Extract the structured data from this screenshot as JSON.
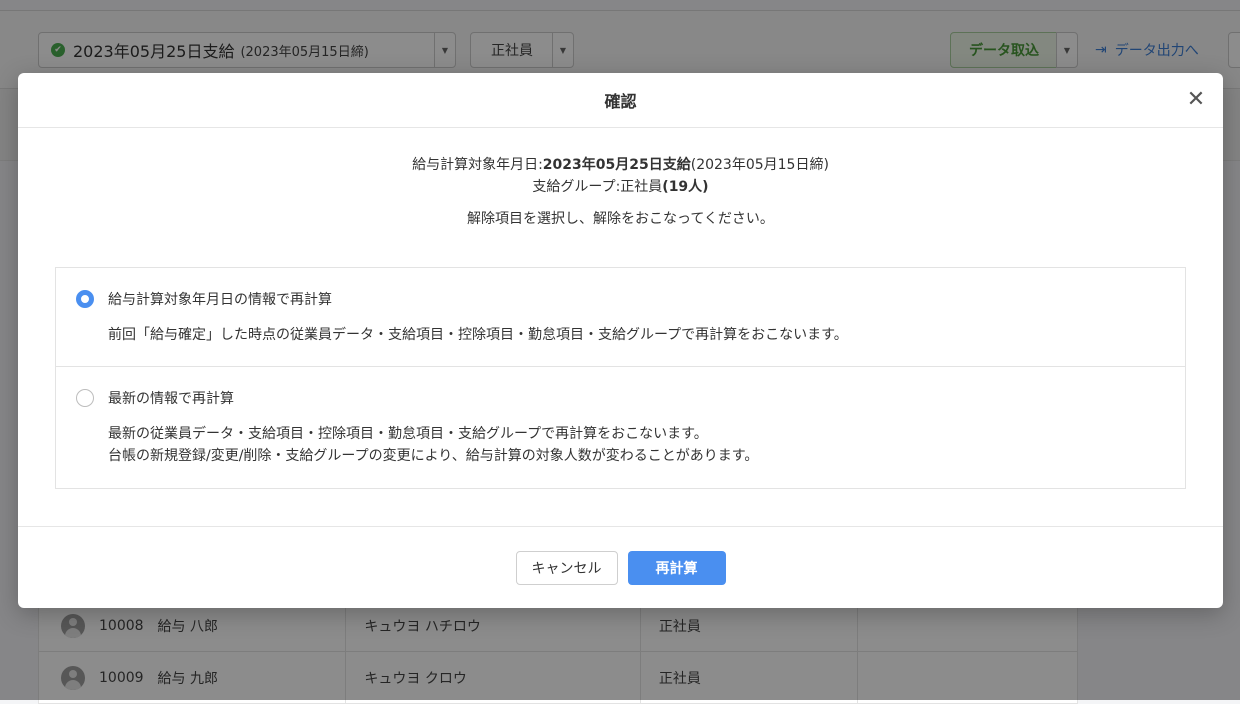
{
  "background": {
    "period_label": "2023年05月25日支給",
    "period_sub": "(2023年05月15日締)",
    "group_select": "正社員",
    "import_button": "データ取込",
    "export_link": "データ出力へ",
    "rows": [
      {
        "code": "10008",
        "name": "給与 八郎",
        "kana": "キュウヨ ハチロウ",
        "group": "正社員"
      },
      {
        "code": "10009",
        "name": "給与 九郎",
        "kana": "キュウヨ クロウ",
        "group": "正社員"
      }
    ]
  },
  "modal": {
    "title": "確認",
    "close_symbol": "✕",
    "info": {
      "target_label": "給与計算対象年月日:",
      "target_value": "2023年05月25日支給",
      "target_sub": "(2023年05月15日締)",
      "group_label": "支給グループ:正社員",
      "group_count": "(19人)",
      "instruction": "解除項目を選択し、解除をおこなってください。"
    },
    "options": [
      {
        "label": "給与計算対象年月日の情報で再計算",
        "checked": true,
        "description_lines": [
          "前回「給与確定」した時点の従業員データ・支給項目・控除項目・勤怠項目・支給グループで再計算をおこないます。"
        ]
      },
      {
        "label": "最新の情報で再計算",
        "checked": false,
        "description_lines": [
          "最新の従業員データ・支給項目・控除項目・勤怠項目・支給グループで再計算をおこないます。",
          "台帳の新規登録/変更/削除・支給グループの変更により、給与計算の対象人数が変わることがあります。"
        ]
      }
    ],
    "cancel_label": "キャンセル",
    "submit_label": "再計算"
  },
  "colors": {
    "primary": "#4a8ff0",
    "success": "#4caf50",
    "overlay": "rgba(0,0,0,0.45)"
  }
}
